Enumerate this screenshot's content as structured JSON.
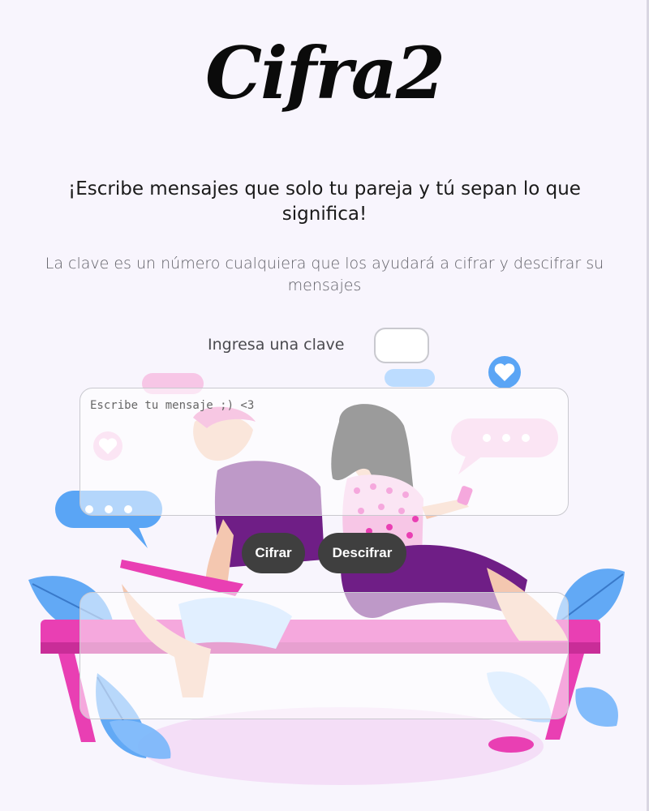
{
  "app": {
    "logo_text": "Cifra2"
  },
  "intro": {
    "headline": "¡Escribe mensajes que solo tu pareja y tú sepan lo que significa!",
    "description": "La clave es un número cualquiera que los ayudará a cifrar y descifrar su mensajes"
  },
  "key": {
    "label": "Ingresa una clave",
    "value": ""
  },
  "message": {
    "placeholder": "Escribe tu mensaje ;) <3",
    "value": ""
  },
  "actions": {
    "encrypt_label": "Cifrar",
    "decrypt_label": "Descifrar"
  },
  "output": {
    "value": ""
  },
  "illustration": {
    "subject": "couple-sitting-on-bench",
    "accent_colors": {
      "pink": "#e93fb3",
      "light_pink": "#f7c6e6",
      "purple": "#6f1e86",
      "blue": "#4f9bf4",
      "light_blue": "#bcdcff",
      "skin": "#f4c7b0",
      "hair": "#222222"
    }
  }
}
